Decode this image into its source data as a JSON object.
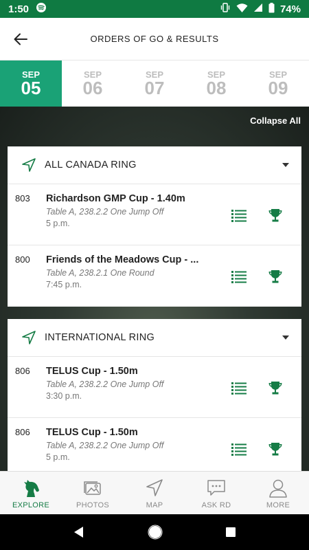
{
  "status": {
    "time": "1:50",
    "battery": "74%"
  },
  "header": {
    "title": "ORDERS OF GO & RESULTS"
  },
  "dates": [
    {
      "month": "SEP",
      "day": "05",
      "active": true
    },
    {
      "month": "SEP",
      "day": "06"
    },
    {
      "month": "SEP",
      "day": "07"
    },
    {
      "month": "SEP",
      "day": "08"
    },
    {
      "month": "SEP",
      "day": "09"
    }
  ],
  "collapse_label": "Collapse All",
  "rings": [
    {
      "name": "ALL CANADA RING",
      "events": [
        {
          "number": "803",
          "name": "Richardson GMP Cup - 1.40m",
          "spec": "Table A, 238.2.2 One Jump Off",
          "time": "5 p.m."
        },
        {
          "number": "800",
          "name": "Friends of the Meadows Cup - ...",
          "spec": "Table A, 238.2.1 One Round",
          "time": "7:45 p.m."
        }
      ]
    },
    {
      "name": "INTERNATIONAL RING",
      "events": [
        {
          "number": "806",
          "name": "TELUS Cup - 1.50m",
          "spec": "Table A, 238.2.2 One Jump Off",
          "time": "3:30 p.m."
        },
        {
          "number": "806",
          "name": "TELUS Cup - 1.50m",
          "spec": "Table A, 238.2.2 One Jump Off",
          "time": "5 p.m."
        }
      ]
    }
  ],
  "bottom_nav": [
    {
      "label": "EXPLORE",
      "icon": "horse-icon",
      "active": true
    },
    {
      "label": "PHOTOS",
      "icon": "photos-icon"
    },
    {
      "label": "MAP",
      "icon": "map-icon"
    },
    {
      "label": "ASK RD",
      "icon": "chat-icon"
    },
    {
      "label": "MORE",
      "icon": "person-icon"
    }
  ],
  "colors": {
    "brand_green": "#167c46",
    "status_green": "#0f7a42",
    "active_date": "#1aa276"
  }
}
